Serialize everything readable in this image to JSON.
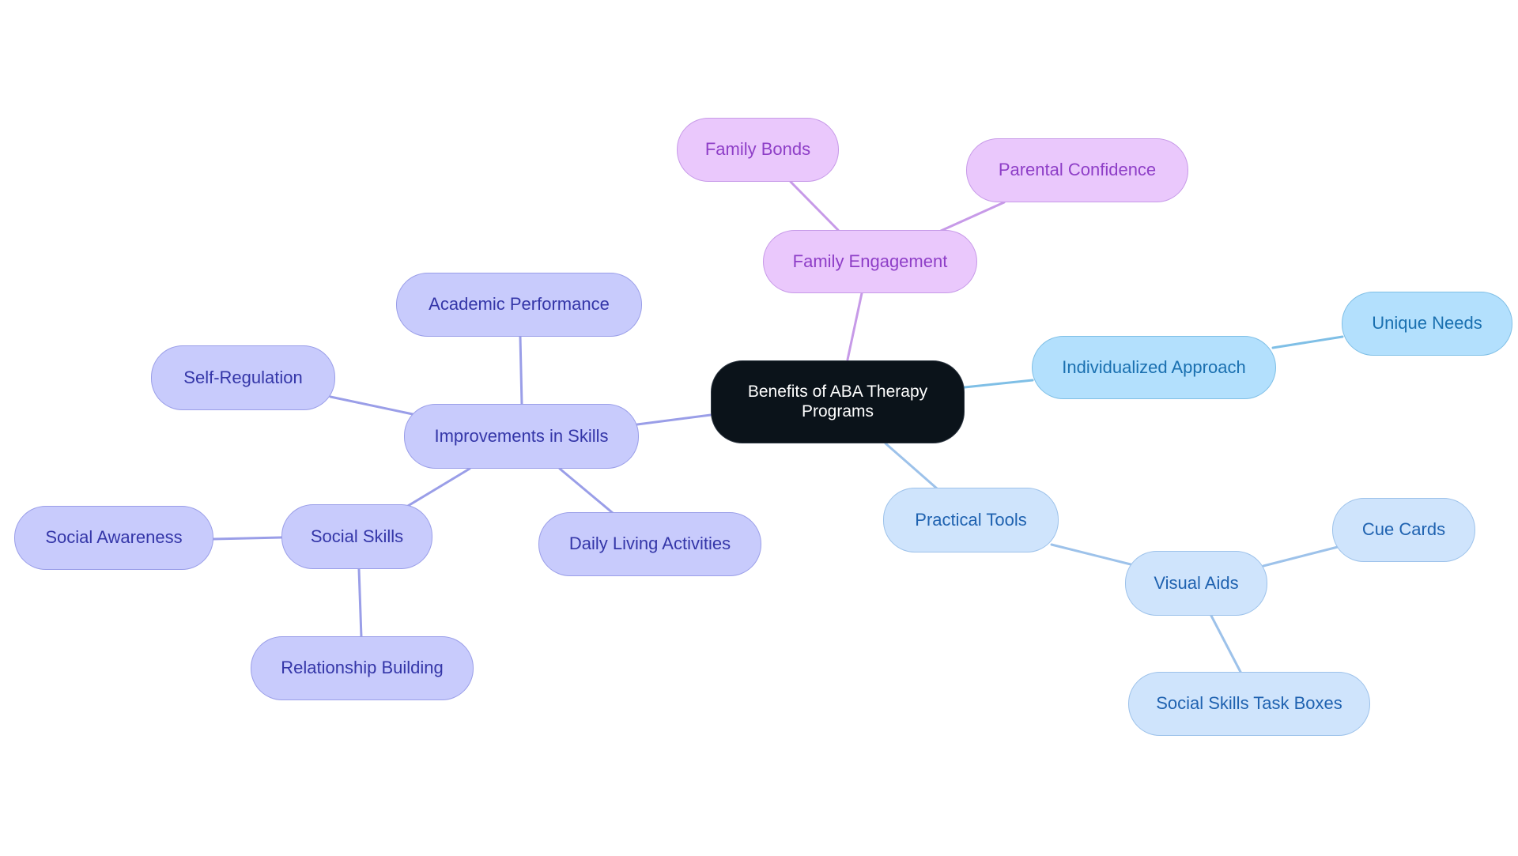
{
  "diagram": {
    "type": "mindmap",
    "root": {
      "id": "root",
      "label": "Benefits of ABA Therapy Programs",
      "lines": [
        "Benefits of ABA Therapy",
        "Programs"
      ]
    },
    "colors": {
      "root_fill": "#0b131a",
      "family_fill": "#eac8fc",
      "family_text": "#8e3ec7",
      "family_edge": "#c79ae8",
      "individual_fill": "#b3e0fd",
      "individual_text": "#1a70b0",
      "individual_edge": "#7fbfe6",
      "tools_fill": "#cfe4fc",
      "tools_text": "#1f62b0",
      "tools_edge": "#9dc2ea",
      "skills_fill": "#c8cbfc",
      "skills_text": "#3436a8",
      "skills_edge": "#9a9ee8"
    },
    "nodes": [
      {
        "id": "family-engagement",
        "label": "Family Engagement",
        "parent": "root",
        "branch": "family"
      },
      {
        "id": "family-bonds",
        "label": "Family Bonds",
        "parent": "family-engagement",
        "branch": "family"
      },
      {
        "id": "parental-confidence",
        "label": "Parental Confidence",
        "parent": "family-engagement",
        "branch": "family"
      },
      {
        "id": "individualized-approach",
        "label": "Individualized Approach",
        "parent": "root",
        "branch": "individual"
      },
      {
        "id": "unique-needs",
        "label": "Unique Needs",
        "parent": "individualized-approach",
        "branch": "individual"
      },
      {
        "id": "practical-tools",
        "label": "Practical Tools",
        "parent": "root",
        "branch": "tools"
      },
      {
        "id": "visual-aids",
        "label": "Visual Aids",
        "parent": "practical-tools",
        "branch": "tools"
      },
      {
        "id": "cue-cards",
        "label": "Cue Cards",
        "parent": "visual-aids",
        "branch": "tools"
      },
      {
        "id": "social-skills-task-boxes",
        "label": "Social Skills Task Boxes",
        "parent": "visual-aids",
        "branch": "tools"
      },
      {
        "id": "improvements-in-skills",
        "label": "Improvements in Skills",
        "parent": "root",
        "branch": "skills"
      },
      {
        "id": "academic-performance",
        "label": "Academic Performance",
        "parent": "improvements-in-skills",
        "branch": "skills"
      },
      {
        "id": "self-regulation",
        "label": "Self-Regulation",
        "parent": "improvements-in-skills",
        "branch": "skills"
      },
      {
        "id": "social-skills",
        "label": "Social Skills",
        "parent": "improvements-in-skills",
        "branch": "skills"
      },
      {
        "id": "social-awareness",
        "label": "Social Awareness",
        "parent": "social-skills",
        "branch": "skills"
      },
      {
        "id": "relationship-building",
        "label": "Relationship Building",
        "parent": "social-skills",
        "branch": "skills"
      },
      {
        "id": "daily-living-activities",
        "label": "Daily Living Activities",
        "parent": "improvements-in-skills",
        "branch": "skills"
      }
    ]
  }
}
